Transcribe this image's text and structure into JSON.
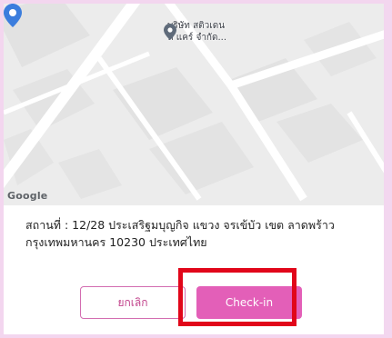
{
  "map": {
    "attribution": "Google",
    "poi_label_line1": "บริษัท สติวเดน",
    "poi_label_line2": "ท์ แคร์ จำกัด..."
  },
  "location": {
    "text": "สถานที่ : 12/28 ประเสริฐมบุญกิจ แขวง จรเข้บัว เขต ลาดพร้าว กรุงเทพมหานคร 10230 ประเทศไทย"
  },
  "actions": {
    "cancel_label": "ยกเลิก",
    "checkin_label": "Check-in"
  },
  "colors": {
    "accent": "#e35fb8",
    "highlight": "#e1061a"
  }
}
